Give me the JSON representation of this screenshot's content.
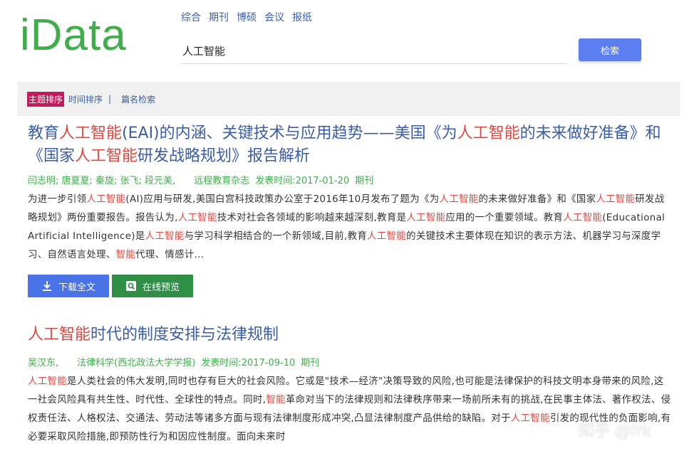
{
  "header": {
    "logo": "iData",
    "nav": [
      "综合",
      "期刊",
      "博硕",
      "会议",
      "报纸"
    ],
    "search_value": "人工智能",
    "search_button": "检索"
  },
  "sort": {
    "active": "主题排序",
    "time": "时间排序",
    "separator": "|",
    "title_search": "篇名检索"
  },
  "results": [
    {
      "title": [
        {
          "t": "教育",
          "h": false
        },
        {
          "t": "人工智能",
          "h": true
        },
        {
          "t": "(EAI)的内涵、关键技术与应用趋势——美国《为",
          "h": false
        },
        {
          "t": "人工智能",
          "h": true
        },
        {
          "t": "的未来做好准备》和《国家",
          "h": false
        },
        {
          "t": "人工智能",
          "h": true
        },
        {
          "t": "研发战略规划》报告解析",
          "h": false
        }
      ],
      "authors": "闫志明; 唐夏夏; 秦旋; 张飞; 段元美,",
      "source": "远程教育杂志",
      "date_label": "发表时间:",
      "date": "2017-01-20",
      "type": "期刊",
      "abstract": [
        {
          "t": "为进一步引领",
          "h": false
        },
        {
          "t": "人工智能",
          "h": true
        },
        {
          "t": "(AI)应用与研发,美国白宫科技政策办公室于2016年10月发布了题为《为",
          "h": false
        },
        {
          "t": "人工智能",
          "h": true
        },
        {
          "t": "的未来做好准备》和《国家",
          "h": false
        },
        {
          "t": "人工智能",
          "h": true
        },
        {
          "t": "研发战略规划》两份重要报告。报告认为,",
          "h": false
        },
        {
          "t": "人工智能",
          "h": true
        },
        {
          "t": "技术对社会各领域的影响越来越深刻,教育是",
          "h": false
        },
        {
          "t": "人工智能",
          "h": true
        },
        {
          "t": "应用的一个重要领域。教育",
          "h": false
        },
        {
          "t": "人工智能",
          "h": true
        },
        {
          "t": "(Educational Artificial Intelligence)是",
          "h": false
        },
        {
          "t": "人工智能",
          "h": true
        },
        {
          "t": "与学习科学相结合的一个新领域,目前,教育",
          "h": false
        },
        {
          "t": "人工智能",
          "h": true
        },
        {
          "t": "的关键技术主要体现在知识的表示方法、机器学习与深度学习、自然语言处理、",
          "h": false
        },
        {
          "t": "智能",
          "h": true
        },
        {
          "t": "代理、情感计...",
          "h": false
        }
      ],
      "download_label": "下载全文",
      "preview_label": "在线预览"
    },
    {
      "title": [
        {
          "t": "人工智能",
          "h": true
        },
        {
          "t": "时代的制度安排与法律规制",
          "h": false
        }
      ],
      "authors": "吴汉东,",
      "source": "法律科学(西北政法大学学报)",
      "date_label": "发表时间:",
      "date": "2017-09-10",
      "type": "期刊",
      "abstract": [
        {
          "t": "人工智能",
          "h": true
        },
        {
          "t": "是人类社会的伟大发明,同时也存有巨大的社会风险。它或是\"技术—经济\"决策导致的风险,也可能是法律保护的科技文明本身带来的风险,这一社会风险具有共生性、时代性、全球性的特点。同时,",
          "h": false
        },
        {
          "t": "智能",
          "h": true
        },
        {
          "t": "革命对当下的法律规则和法律秩序带来一场前所未有的挑战,在民事主体法、著作权法、侵权责任法、人格权法、交通法、劳动法等诸多方面与现有法律制度形成冲突,凸显法律制度产品供给的缺陷。对于",
          "h": false
        },
        {
          "t": "人工智能",
          "h": true
        },
        {
          "t": "引发的现代性的负面影响,有必要采取风险措施,即预防性行为和因应性制度。面向未来时",
          "h": false
        }
      ]
    }
  ],
  "watermark": "知乎 @frk",
  "colors": {
    "brand_green": "#3fae4a",
    "link_blue": "#3b5da8",
    "highlight_red": "#e0473f",
    "active_sort": "#c3195d",
    "search_button": "#5b7ff1",
    "download_button": "#4a73e8",
    "preview_button": "#2f8f46"
  }
}
